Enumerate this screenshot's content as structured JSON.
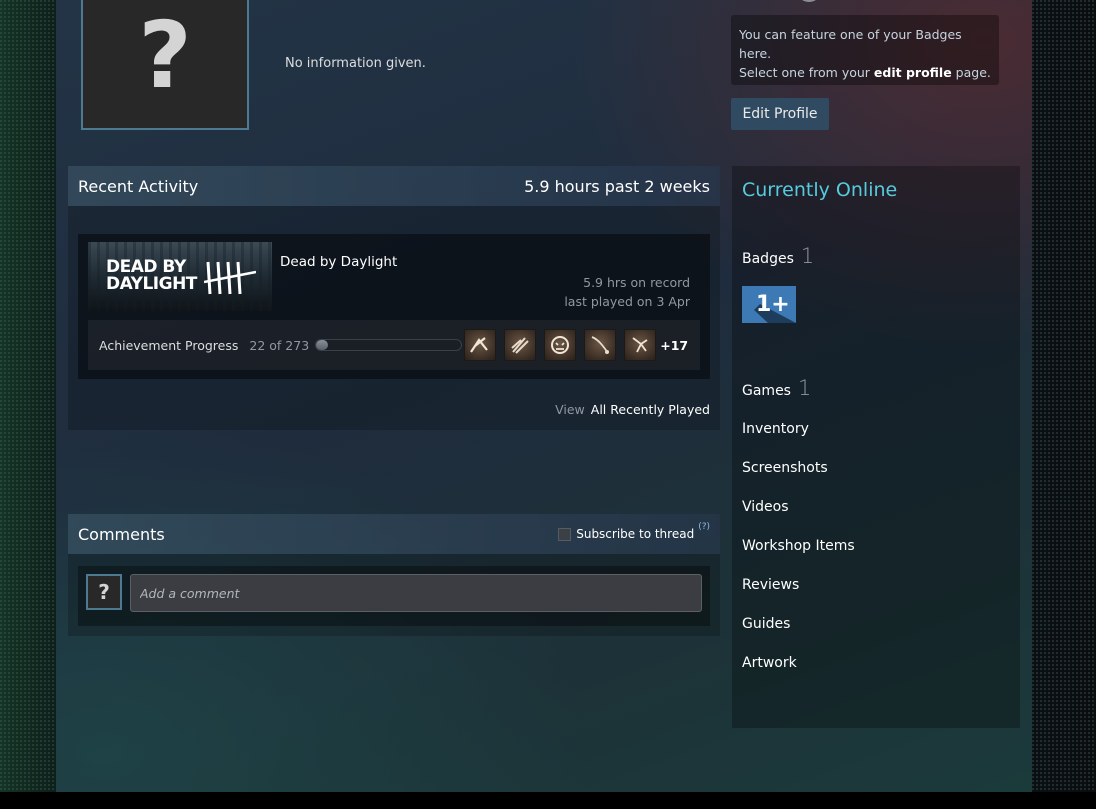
{
  "profile": {
    "summary": "No information given.",
    "avatar_glyph": "?"
  },
  "badge_feature": {
    "text_1": "You can feature one of your Badges here.",
    "text_2": "Select one from your ",
    "link": "edit profile",
    "text_3": " page."
  },
  "edit_profile_label": "Edit Profile",
  "recent_activity": {
    "title": "Recent Activity",
    "hours_summary": "5.9 hours past 2 weeks",
    "game": {
      "capsule_line_1": "DEAD BY",
      "capsule_line_2": "DAYLIGHT",
      "name": "Dead by Daylight",
      "hours": "5.9 hrs on record",
      "last_played": "last played on 3 Apr"
    },
    "achievements": {
      "label": "Achievement Progress",
      "count": "22 of 273",
      "progress_fraction": 0.0806,
      "icons": [
        "achievement-icon",
        "achievement-icon",
        "achievement-icon",
        "achievement-icon",
        "achievement-icon"
      ],
      "more": "+17"
    },
    "view_label": "View",
    "view_link": "All Recently Played"
  },
  "comments": {
    "title": "Comments",
    "subscribe_label": "Subscribe to thread",
    "help": "(?)",
    "placeholder": "Add a comment",
    "avatar_glyph": "?"
  },
  "sidebar": {
    "status": "Currently Online",
    "badges_label": "Badges",
    "badges_count": "1",
    "badge_glyph": "1+",
    "games_label": "Games",
    "games_count": "1",
    "links": [
      "Inventory",
      "Screenshots",
      "Videos",
      "Workshop Items",
      "Reviews",
      "Guides",
      "Artwork"
    ]
  },
  "colors": {
    "online": "#57cbde",
    "accent_button": "#2f4a61",
    "badge_blue": "#3d7ab5"
  }
}
